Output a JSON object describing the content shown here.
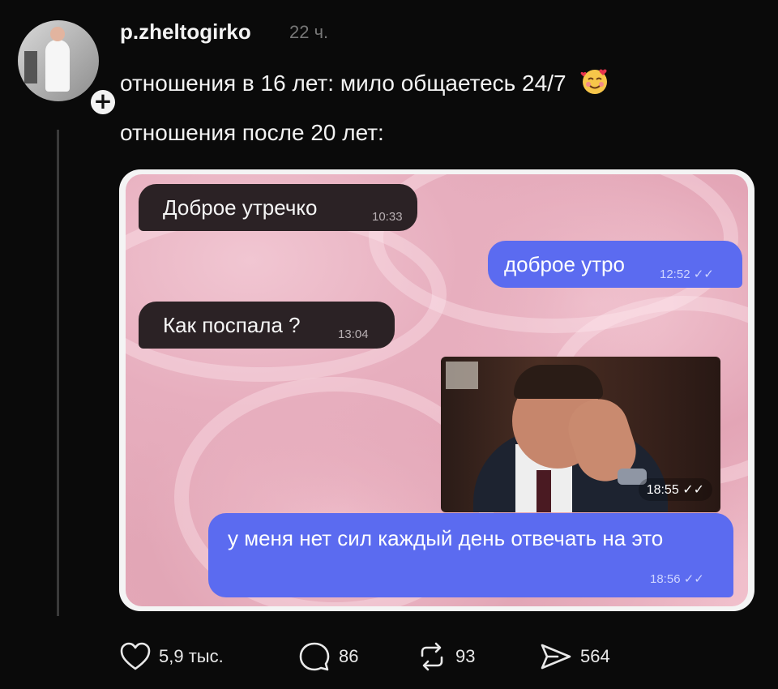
{
  "post": {
    "username": "p.zheltogirko",
    "time": "22 ч.",
    "line1": "отношения в 16 лет: мило общаетесь 24/7",
    "line1_emoji": "🥰",
    "line2": "отношения после 20 лет:"
  },
  "chat": {
    "messages": [
      {
        "side": "incoming",
        "text": "Доброе утречко",
        "time": "10:33"
      },
      {
        "side": "outgoing",
        "text": "доброе утро",
        "time": "12:52"
      },
      {
        "side": "incoming",
        "text": "Как поспала ?",
        "time": "13:04"
      },
      {
        "side": "outgoing",
        "type": "photo",
        "time": "18:55"
      },
      {
        "side": "outgoing",
        "text": "у меня нет сил каждый день отвечать на это",
        "time": "18:56"
      }
    ]
  },
  "actions": {
    "likes": "5,9 тыс.",
    "comments": "86",
    "reposts": "93",
    "shares": "564"
  },
  "icons": [
    "plus-icon",
    "heart-icon",
    "comment-icon",
    "repost-icon",
    "share-icon"
  ],
  "colors": {
    "background": "#0a0a0a",
    "incoming_bubble": "#2b2225",
    "outgoing_bubble": "#5b6bf0",
    "chat_background": "#e7aebe"
  }
}
